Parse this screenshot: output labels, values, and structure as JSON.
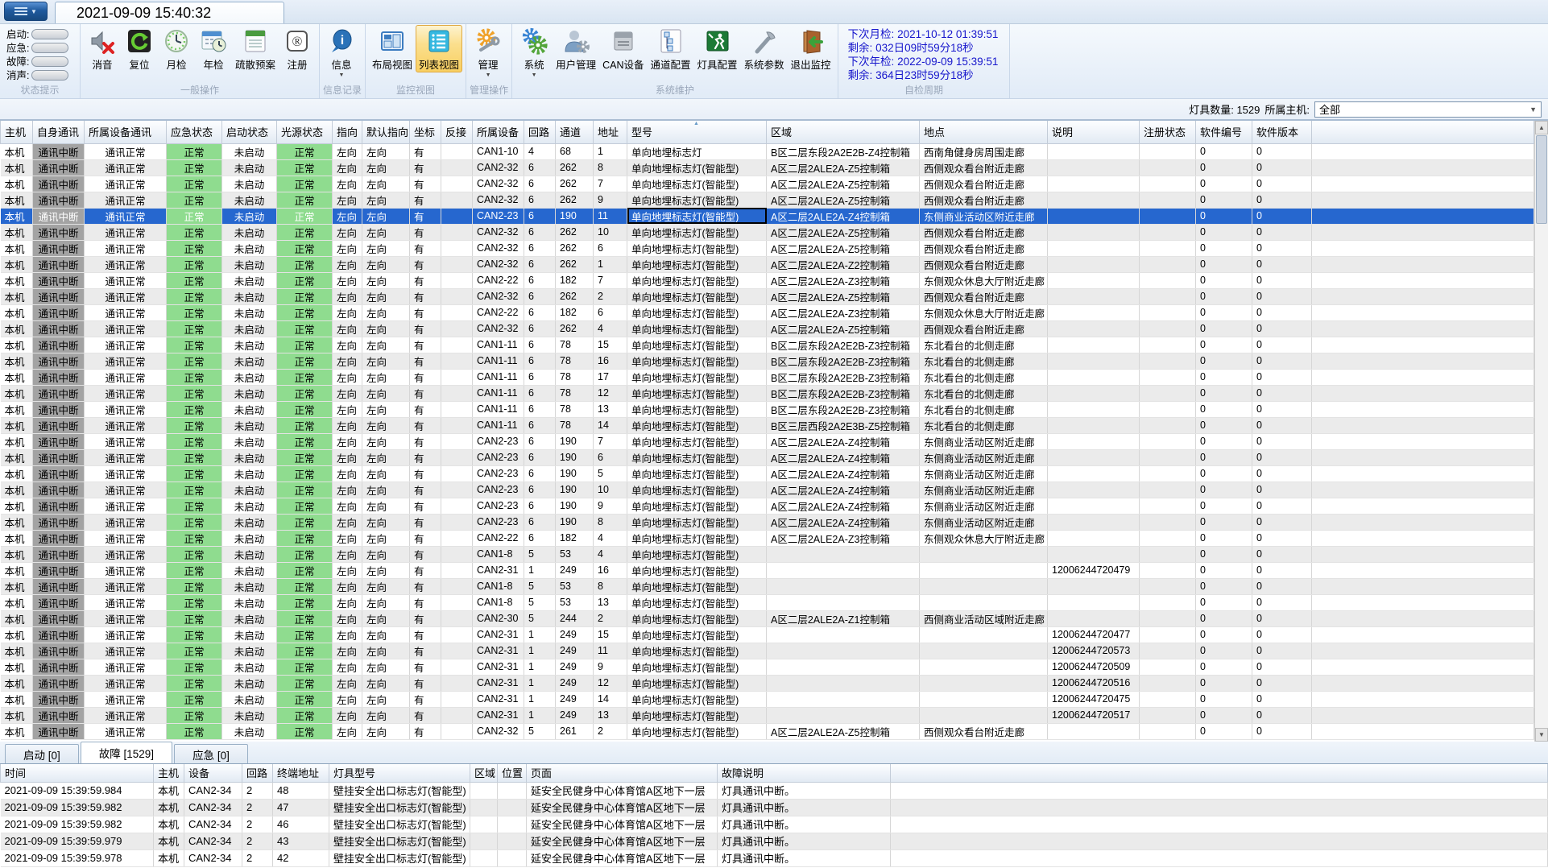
{
  "window": {
    "tab_title": "2021-09-09 15:40:32"
  },
  "status_panel": {
    "group_label": "状态提示",
    "items": [
      {
        "label": "启动:"
      },
      {
        "label": "应急:"
      },
      {
        "label": "故障:"
      },
      {
        "label": "消声:"
      }
    ]
  },
  "toolbar": {
    "groups": [
      {
        "label": "一般操作",
        "buttons": [
          {
            "label": "消音",
            "icon": "mute-icon"
          },
          {
            "label": "复位",
            "icon": "reset-icon"
          },
          {
            "label": "月检",
            "icon": "monthly-check-icon"
          },
          {
            "label": "年检",
            "icon": "annual-check-icon"
          },
          {
            "label": "疏散预案",
            "icon": "evacuation-plan-icon"
          },
          {
            "label": "注册",
            "icon": "register-icon"
          }
        ]
      },
      {
        "label": "信息记录",
        "buttons": [
          {
            "label": "信息",
            "icon": "info-icon",
            "dropdown": true
          }
        ]
      },
      {
        "label": "监控视图",
        "buttons": [
          {
            "label": "布局视图",
            "icon": "layout-view-icon"
          },
          {
            "label": "列表视图",
            "icon": "list-view-icon",
            "active": true
          }
        ]
      },
      {
        "label": "管理操作",
        "buttons": [
          {
            "label": "管理",
            "icon": "manage-icon",
            "dropdown": true
          }
        ]
      },
      {
        "label": "系统维护",
        "buttons": [
          {
            "label": "系统",
            "icon": "system-icon",
            "dropdown": true
          },
          {
            "label": "用户管理",
            "icon": "user-management-icon"
          },
          {
            "label": "CAN设备",
            "icon": "can-device-icon"
          },
          {
            "label": "通道配置",
            "icon": "channel-config-icon"
          },
          {
            "label": "灯具配置",
            "icon": "lamp-config-icon"
          },
          {
            "label": "系统参数",
            "icon": "system-params-icon"
          },
          {
            "label": "退出监控",
            "icon": "exit-monitor-icon"
          }
        ]
      }
    ],
    "self_check": {
      "group_label": "自检周期",
      "next_monthly": "下次月检: 2021-10-12 01:39:51",
      "monthly_remaining": "剩余: 032日09时59分18秒",
      "next_annual": "下次年检: 2022-09-09 15:39:51",
      "annual_remaining": "剩余: 364日23时59分18秒"
    }
  },
  "filter_bar": {
    "lamp_count_label": "灯具数量: 1529",
    "host_label": "所属主机:",
    "host_value": "全部"
  },
  "main_table": {
    "columns": [
      "主机",
      "自身通讯",
      "所属设备通讯",
      "应急状态",
      "启动状态",
      "光源状态",
      "指向",
      "默认指向",
      "坐标",
      "反接",
      "所属设备",
      "回路",
      "通道",
      "地址",
      "型号",
      "区域",
      "地点",
      "说明",
      "注册状态",
      "软件编号",
      "软件版本"
    ],
    "sorted_column": "型号",
    "row_prefix": [
      "本机",
      "通讯中断",
      "通讯正常",
      "正常",
      "未启动",
      "正常",
      "左向",
      "左向",
      "有",
      ""
    ],
    "row_suffix": [
      "",
      "0",
      "0"
    ],
    "selected_row": 4,
    "focus_col": 14,
    "rows": [
      [
        "CAN1-10",
        "4",
        "68",
        "1",
        "单向地埋标志灯",
        "B区二层东段2A2E2B-Z4控制箱",
        "西南角健身房周围走廊",
        ""
      ],
      [
        "CAN2-32",
        "6",
        "262",
        "8",
        "单向地埋标志灯(智能型)",
        "A区二层2ALE2A-Z5控制箱",
        "西侧观众看台附近走廊",
        ""
      ],
      [
        "CAN2-32",
        "6",
        "262",
        "7",
        "单向地埋标志灯(智能型)",
        "A区二层2ALE2A-Z5控制箱",
        "西侧观众看台附近走廊",
        ""
      ],
      [
        "CAN2-32",
        "6",
        "262",
        "9",
        "单向地埋标志灯(智能型)",
        "A区二层2ALE2A-Z5控制箱",
        "西侧观众看台附近走廊",
        ""
      ],
      [
        "CAN2-23",
        "6",
        "190",
        "11",
        "单向地埋标志灯(智能型)",
        "A区二层2ALE2A-Z4控制箱",
        "东侧商业活动区附近走廊",
        ""
      ],
      [
        "CAN2-32",
        "6",
        "262",
        "10",
        "单向地埋标志灯(智能型)",
        "A区二层2ALE2A-Z5控制箱",
        "西侧观众看台附近走廊",
        ""
      ],
      [
        "CAN2-32",
        "6",
        "262",
        "6",
        "单向地埋标志灯(智能型)",
        "A区二层2ALE2A-Z5控制箱",
        "西侧观众看台附近走廊",
        ""
      ],
      [
        "CAN2-32",
        "6",
        "262",
        "1",
        "单向地埋标志灯(智能型)",
        "A区二层2ALE2A-Z2控制箱",
        "西侧观众看台附近走廊",
        ""
      ],
      [
        "CAN2-22",
        "6",
        "182",
        "7",
        "单向地埋标志灯(智能型)",
        "A区二层2ALE2A-Z3控制箱",
        "东侧观众休息大厅附近走廊",
        ""
      ],
      [
        "CAN2-32",
        "6",
        "262",
        "2",
        "单向地埋标志灯(智能型)",
        "A区二层2ALE2A-Z5控制箱",
        "西侧观众看台附近走廊",
        ""
      ],
      [
        "CAN2-22",
        "6",
        "182",
        "6",
        "单向地埋标志灯(智能型)",
        "A区二层2ALE2A-Z3控制箱",
        "东侧观众休息大厅附近走廊",
        ""
      ],
      [
        "CAN2-32",
        "6",
        "262",
        "4",
        "单向地埋标志灯(智能型)",
        "A区二层2ALE2A-Z5控制箱",
        "西侧观众看台附近走廊",
        ""
      ],
      [
        "CAN1-11",
        "6",
        "78",
        "15",
        "单向地埋标志灯(智能型)",
        "B区二层东段2A2E2B-Z3控制箱",
        "东北看台的北侧走廊",
        ""
      ],
      [
        "CAN1-11",
        "6",
        "78",
        "16",
        "单向地埋标志灯(智能型)",
        "B区二层东段2A2E2B-Z3控制箱",
        "东北看台的北侧走廊",
        ""
      ],
      [
        "CAN1-11",
        "6",
        "78",
        "17",
        "单向地埋标志灯(智能型)",
        "B区二层东段2A2E2B-Z3控制箱",
        "东北看台的北侧走廊",
        ""
      ],
      [
        "CAN1-11",
        "6",
        "78",
        "12",
        "单向地埋标志灯(智能型)",
        "B区二层东段2A2E2B-Z3控制箱",
        "东北看台的北侧走廊",
        ""
      ],
      [
        "CAN1-11",
        "6",
        "78",
        "13",
        "单向地埋标志灯(智能型)",
        "B区二层东段2A2E2B-Z3控制箱",
        "东北看台的北侧走廊",
        ""
      ],
      [
        "CAN1-11",
        "6",
        "78",
        "14",
        "单向地埋标志灯(智能型)",
        "B区三层西段2A2E3B-Z5控制箱",
        "东北看台的北侧走廊",
        ""
      ],
      [
        "CAN2-23",
        "6",
        "190",
        "7",
        "单向地埋标志灯(智能型)",
        "A区二层2ALE2A-Z4控制箱",
        "东侧商业活动区附近走廊",
        ""
      ],
      [
        "CAN2-23",
        "6",
        "190",
        "6",
        "单向地埋标志灯(智能型)",
        "A区二层2ALE2A-Z4控制箱",
        "东侧商业活动区附近走廊",
        ""
      ],
      [
        "CAN2-23",
        "6",
        "190",
        "5",
        "单向地埋标志灯(智能型)",
        "A区二层2ALE2A-Z4控制箱",
        "东侧商业活动区附近走廊",
        ""
      ],
      [
        "CAN2-23",
        "6",
        "190",
        "10",
        "单向地埋标志灯(智能型)",
        "A区二层2ALE2A-Z4控制箱",
        "东侧商业活动区附近走廊",
        ""
      ],
      [
        "CAN2-23",
        "6",
        "190",
        "9",
        "单向地埋标志灯(智能型)",
        "A区二层2ALE2A-Z4控制箱",
        "东侧商业活动区附近走廊",
        ""
      ],
      [
        "CAN2-23",
        "6",
        "190",
        "8",
        "单向地埋标志灯(智能型)",
        "A区二层2ALE2A-Z4控制箱",
        "东侧商业活动区附近走廊",
        ""
      ],
      [
        "CAN2-22",
        "6",
        "182",
        "4",
        "单向地埋标志灯(智能型)",
        "A区二层2ALE2A-Z3控制箱",
        "东侧观众休息大厅附近走廊",
        ""
      ],
      [
        "CAN1-8",
        "5",
        "53",
        "4",
        "单向地埋标志灯(智能型)",
        "",
        "",
        ""
      ],
      [
        "CAN2-31",
        "1",
        "249",
        "16",
        "单向地埋标志灯(智能型)",
        "",
        "",
        "12006244720479"
      ],
      [
        "CAN1-8",
        "5",
        "53",
        "8",
        "单向地埋标志灯(智能型)",
        "",
        "",
        ""
      ],
      [
        "CAN1-8",
        "5",
        "53",
        "13",
        "单向地埋标志灯(智能型)",
        "",
        "",
        ""
      ],
      [
        "CAN2-30",
        "5",
        "244",
        "2",
        "单向地埋标志灯(智能型)",
        "A区二层2ALE2A-Z1控制箱",
        "西侧商业活动区域附近走廊",
        ""
      ],
      [
        "CAN2-31",
        "1",
        "249",
        "15",
        "单向地埋标志灯(智能型)",
        "",
        "",
        "12006244720477"
      ],
      [
        "CAN2-31",
        "1",
        "249",
        "11",
        "单向地埋标志灯(智能型)",
        "",
        "",
        "12006244720573"
      ],
      [
        "CAN2-31",
        "1",
        "249",
        "9",
        "单向地埋标志灯(智能型)",
        "",
        "",
        "12006244720509"
      ],
      [
        "CAN2-31",
        "1",
        "249",
        "12",
        "单向地埋标志灯(智能型)",
        "",
        "",
        "12006244720516"
      ],
      [
        "CAN2-31",
        "1",
        "249",
        "14",
        "单向地埋标志灯(智能型)",
        "",
        "",
        "12006244720475"
      ],
      [
        "CAN2-31",
        "1",
        "249",
        "13",
        "单向地埋标志灯(智能型)",
        "",
        "",
        "12006244720517"
      ],
      [
        "CAN2-32",
        "5",
        "261",
        "2",
        "单向地埋标志灯(智能型)",
        "A区二层2ALE2A-Z5控制箱",
        "西侧观众看台附近走廊",
        ""
      ]
    ]
  },
  "bottom_panel": {
    "tabs": [
      {
        "label": "启动 [0]"
      },
      {
        "label": "故障 [1529]",
        "active": true
      },
      {
        "label": "应急 [0]"
      }
    ],
    "columns": [
      "时间",
      "主机",
      "设备",
      "回路",
      "终端地址",
      "灯具型号",
      "区域",
      "位置",
      "页面",
      "故障说明"
    ],
    "rows": [
      [
        "2021-09-09 15:39:59.984",
        "本机",
        "CAN2-34",
        "2",
        "48",
        "壁挂安全出口标志灯(智能型)",
        "",
        "",
        "延安全民健身中心体育馆A区地下一层",
        "灯具通讯中断。"
      ],
      [
        "2021-09-09 15:39:59.982",
        "本机",
        "CAN2-34",
        "2",
        "47",
        "壁挂安全出口标志灯(智能型)",
        "",
        "",
        "延安全民健身中心体育馆A区地下一层",
        "灯具通讯中断。"
      ],
      [
        "2021-09-09 15:39:59.982",
        "本机",
        "CAN2-34",
        "2",
        "46",
        "壁挂安全出口标志灯(智能型)",
        "",
        "",
        "延安全民健身中心体育馆A区地下一层",
        "灯具通讯中断。"
      ],
      [
        "2021-09-09 15:39:59.979",
        "本机",
        "CAN2-34",
        "2",
        "43",
        "壁挂安全出口标志灯(智能型)",
        "",
        "",
        "延安全民健身中心体育馆A区地下一层",
        "灯具通讯中断。"
      ],
      [
        "2021-09-09 15:39:59.978",
        "本机",
        "CAN2-34",
        "2",
        "42",
        "壁挂安全出口标志灯(智能型)",
        "",
        "",
        "延安全民健身中心体育馆A区地下一层",
        "灯具通讯中断。"
      ]
    ]
  },
  "colors": {
    "selection": "#2667cf",
    "comm_break_bg": "#a3a3a3",
    "normal_bg": "#8fdc8f",
    "active_button_bg": "#fbdf8d",
    "self_check_text": "#1616cc"
  }
}
